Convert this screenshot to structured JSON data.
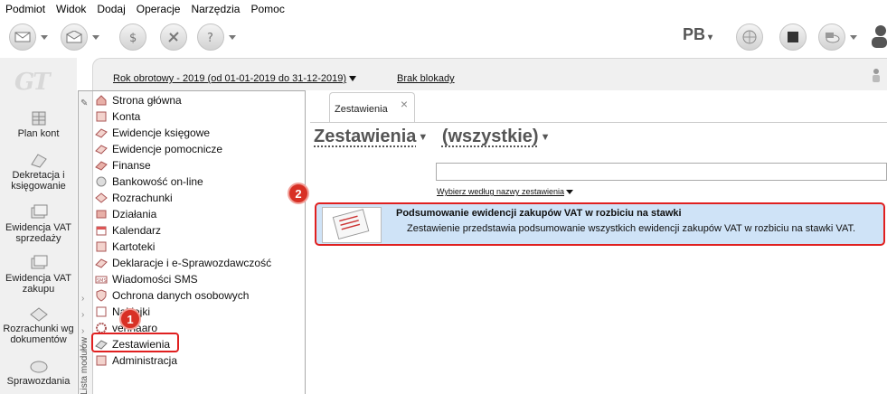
{
  "menu": [
    "Podmiot",
    "Widok",
    "Dodaj",
    "Operacje",
    "Narzędzia",
    "Pomoc"
  ],
  "toolbar": {
    "user_initials": "PB",
    "buttons": [
      "envelope-icon",
      "envelope-open-icon",
      "money-icon",
      "tools-icon",
      "help-icon"
    ],
    "right_icons": [
      "globe-icon",
      "box-icon",
      "cloud-sync-icon",
      "user-icon"
    ]
  },
  "logo": "GT",
  "left_nav": [
    {
      "label": "Plan kont",
      "icon": "ledger-icon"
    },
    {
      "label": "Dekretacja i księgowanie",
      "icon": "post-icon"
    },
    {
      "label": "Ewidencja VAT sprzedaży",
      "icon": "vat-sales-icon"
    },
    {
      "label": "Ewidencja VAT zakupu",
      "icon": "vat-purchase-icon"
    },
    {
      "label": "Rozrachunki wg dokumentów",
      "icon": "settlements-icon"
    },
    {
      "label": "Sprawozdania",
      "icon": "reports-icon"
    }
  ],
  "header": {
    "fiscal_year": "Rok obrotowy - 2019  (od 01-01-2019 do 31-12-2019)",
    "lock_status": "Brak blokady"
  },
  "modules": {
    "side_label": "Lista modułów",
    "items": [
      "Strona główna",
      "Konta",
      "Ewidencje księgowe",
      "Ewidencje pomocnicze",
      "Finanse",
      "Bankowość on-line",
      "Rozrachunki",
      "Działania",
      "Kalendarz",
      "Kartoteki",
      "Deklaracje i e-Sprawozdawczość",
      "Wiadomości SMS",
      "Ochrona danych osobowych",
      "Naklejki",
      "venhaaro",
      "Zestawienia",
      "Administracja"
    ]
  },
  "badges": [
    "1",
    "2"
  ],
  "tab": {
    "label": "Zestawienia"
  },
  "content": {
    "title": "Zestawienia",
    "filter": "(wszystkie)",
    "search_value": "",
    "choose_label": "Wybierz według nazwy zestawienia",
    "result": {
      "title": "Podsumowanie ewidencji zakupów VAT w rozbiciu na stawki",
      "description": "Zestawienie przedstawia podsumowanie wszystkich ewidencji zakupów VAT w rozbiciu na stawki VAT."
    }
  },
  "colors": {
    "highlight": "#e02020",
    "badge": "#d83025",
    "result_bg": "#cfe3f7"
  }
}
